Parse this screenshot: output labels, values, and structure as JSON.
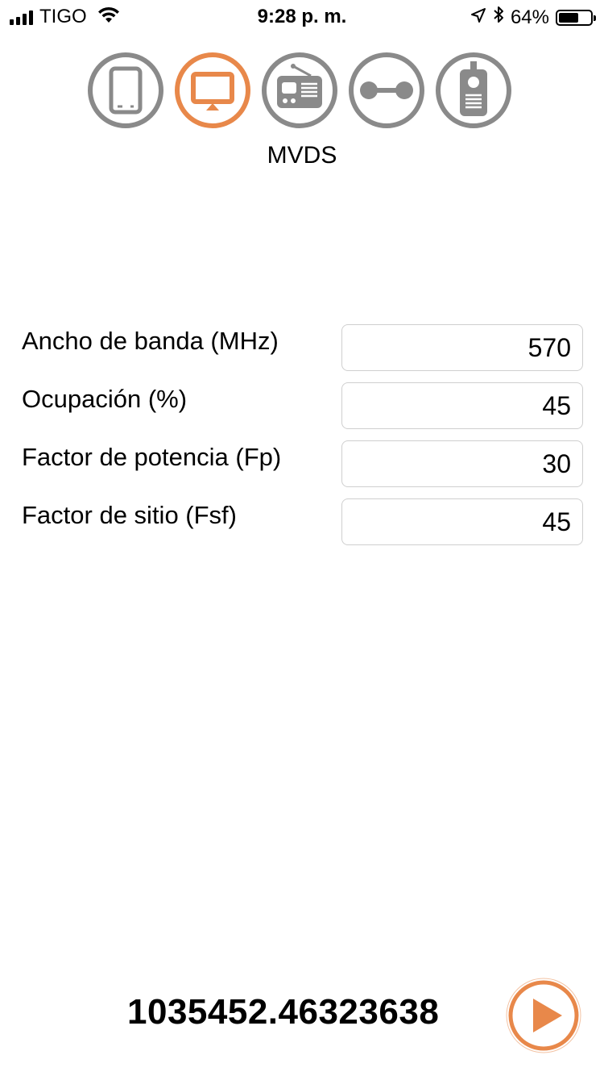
{
  "status_bar": {
    "carrier": "TIGO",
    "time": "9:28 p. m.",
    "battery_percent_label": "64%",
    "battery_level": 0.64
  },
  "modes": {
    "items": [
      {
        "icon": "tablet-icon",
        "selected": false
      },
      {
        "icon": "monitor-icon",
        "selected": true
      },
      {
        "icon": "radio-icon",
        "selected": false
      },
      {
        "icon": "link-icon",
        "selected": false
      },
      {
        "icon": "walkie-talkie-icon",
        "selected": false
      }
    ],
    "selected_label": "MVDS"
  },
  "form": {
    "fields": [
      {
        "label": "Ancho de banda (MHz)",
        "value": "570"
      },
      {
        "label": "Ocupación (%)",
        "value": "45"
      },
      {
        "label": "Factor de potencia (Fp)",
        "value": "30"
      },
      {
        "label": "Factor de sitio (Fsf)",
        "value": "45"
      }
    ]
  },
  "result": {
    "value": "1035452.46323638"
  },
  "colors": {
    "accent": "#E8884A",
    "inactive": "#8A8A8A"
  }
}
